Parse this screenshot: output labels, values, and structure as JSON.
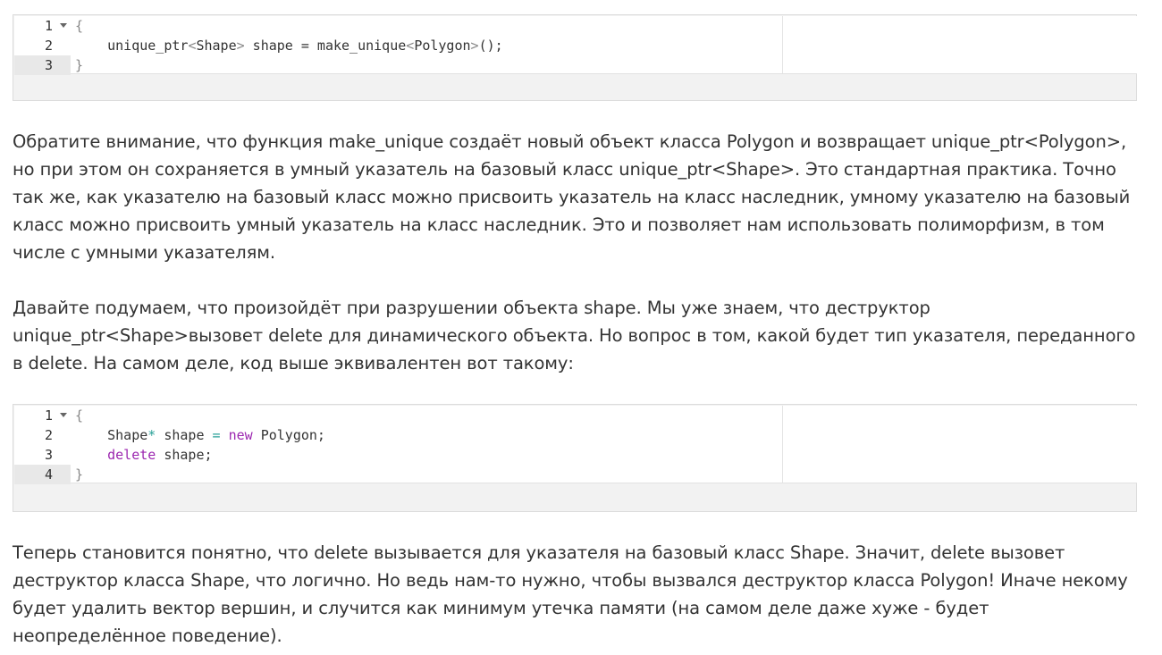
{
  "code_blocks": [
    {
      "lines": [
        {
          "num": "1",
          "fold": true,
          "parts": [
            {
              "t": "{",
              "c": "tok-punct"
            }
          ]
        },
        {
          "num": "2",
          "fold": false,
          "parts": [
            {
              "t": "    unique_ptr",
              "c": "tok-type"
            },
            {
              "t": "<",
              "c": "tok-punct"
            },
            {
              "t": "Shape",
              "c": "tok-type"
            },
            {
              "t": ">",
              "c": "tok-punct"
            },
            {
              "t": " shape ",
              "c": "tok-type"
            },
            {
              "t": "=",
              "c": "tok-type"
            },
            {
              "t": " make_unique",
              "c": "tok-type"
            },
            {
              "t": "<",
              "c": "tok-punct"
            },
            {
              "t": "Polygon",
              "c": "tok-type"
            },
            {
              "t": ">",
              "c": "tok-punct"
            },
            {
              "t": "();",
              "c": "tok-type"
            }
          ]
        },
        {
          "num": "3",
          "fold": false,
          "active": true,
          "parts": [
            {
              "t": "}",
              "c": "tok-punct"
            }
          ]
        }
      ]
    },
    {
      "lines": [
        {
          "num": "1",
          "fold": true,
          "parts": [
            {
              "t": "{",
              "c": "tok-punct"
            }
          ]
        },
        {
          "num": "2",
          "fold": false,
          "parts": [
            {
              "t": "    Shape",
              "c": "tok-type"
            },
            {
              "t": "*",
              "c": "tok-op"
            },
            {
              "t": " shape ",
              "c": "tok-type"
            },
            {
              "t": "=",
              "c": "tok-op"
            },
            {
              "t": " ",
              "c": "tok-type"
            },
            {
              "t": "new",
              "c": "tok-kw"
            },
            {
              "t": " Polygon;",
              "c": "tok-type"
            }
          ]
        },
        {
          "num": "3",
          "fold": false,
          "parts": [
            {
              "t": "    ",
              "c": "tok-type"
            },
            {
              "t": "delete",
              "c": "tok-kw"
            },
            {
              "t": " shape;",
              "c": "tok-type"
            }
          ]
        },
        {
          "num": "4",
          "fold": false,
          "active": true,
          "parts": [
            {
              "t": "}",
              "c": "tok-punct"
            }
          ]
        }
      ]
    }
  ],
  "paragraphs": {
    "p1": "Обратите внимание, что функция make_unique создаёт новый объект класса Polygon и возвращает unique_ptr<Polygon>, но при этом он сохраняется в умный указатель на базовый класс unique_ptr<Shape>. Это стандартная практика. Точно так же, как указателю на базовый класс можно присвоить указатель на класс наследник, умному указателю на базовый класс можно присвоить умный указатель на класс наследник. Это и позволяет нам использовать полиморфизм, в том числе с умными указателям.",
    "p2": "Давайте подумаем, что произойдёт при разрушении объекта shape. Мы уже знаем, что деструктор unique_ptr<Shape>вызовет delete для динамического объекта. Но вопрос в том, какой будет тип указателя, переданного в delete. На самом деле, код выше эквивалентен вот такому:",
    "p3": "Теперь становится понятно, что delete вызывается для указателя на базовый класс Shape. Значит, delete вызовет деструктор класса Shape, что логично. Но ведь нам-то нужно, чтобы вызвался деструктор класса Polygon! Иначе некому будет удалить вектор вершин, и случится как минимум утечка памяти (на самом деле даже хуже - будет неопределённое поведение)."
  }
}
